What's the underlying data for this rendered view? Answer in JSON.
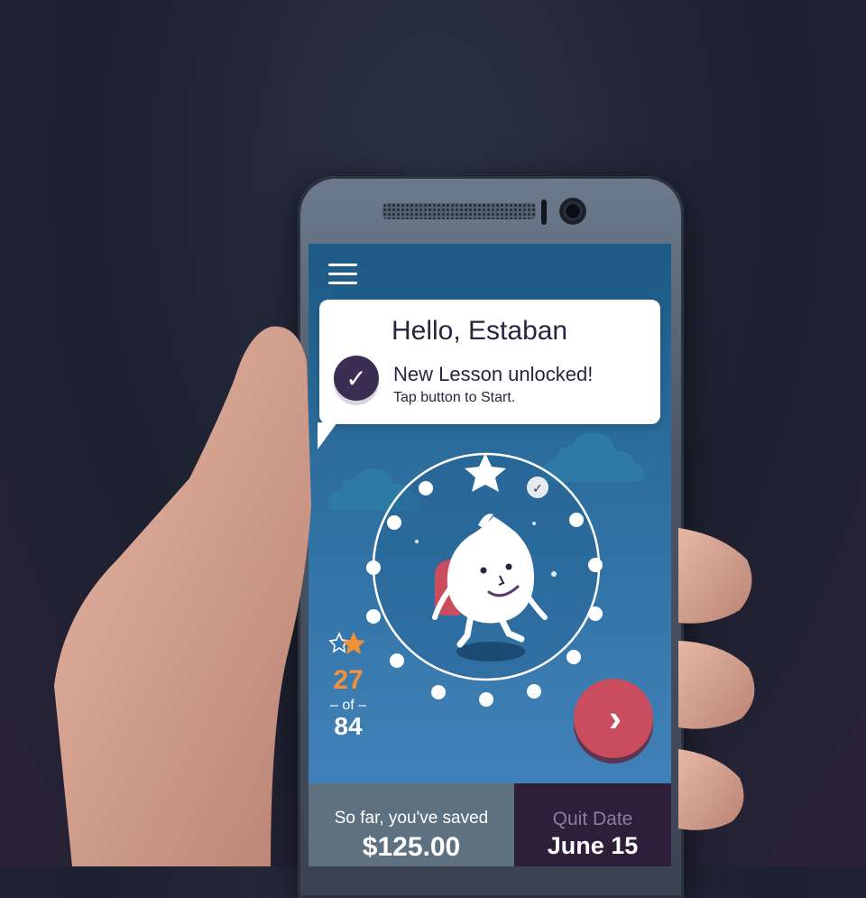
{
  "header": {
    "menu_icon": "hamburger-menu-icon"
  },
  "message": {
    "greeting": "Hello, Estaban",
    "title": "New Lesson unlocked!",
    "subtitle": "Tap button to Start.",
    "icon": "check-circle-icon"
  },
  "progress": {
    "completed": "27",
    "of_label": "of",
    "total": "84",
    "icon": "stars-icon"
  },
  "next_button": {
    "icon": "chevron-right-icon"
  },
  "footer": {
    "saved_label": "So far, you've saved",
    "saved_value": "$125.00",
    "quit_label": "Quit Date",
    "quit_value": "June 15"
  },
  "colors": {
    "screen_top": "#1d5a84",
    "screen_bottom": "#4585bd",
    "accent_red": "#c94d5c",
    "accent_orange": "#f0913a",
    "dark_purple": "#2d1e3a",
    "slate": "#5e7180"
  }
}
